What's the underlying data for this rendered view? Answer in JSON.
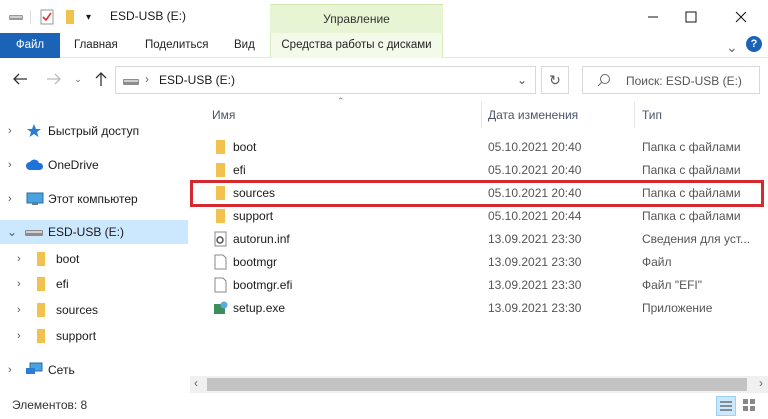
{
  "window": {
    "title": "ESD-USB (E:)",
    "manage_tab": "Управление"
  },
  "ribbon": {
    "tabs": [
      "Файл",
      "Главная",
      "Поделиться",
      "Вид",
      "Средства работы с дисками"
    ]
  },
  "address": {
    "path": "ESD-USB (E:)",
    "search_placeholder": "Поиск: ESD-USB (E:)"
  },
  "nav": {
    "items": [
      {
        "label": "Быстрый доступ",
        "icon": "star-icon"
      },
      {
        "label": "OneDrive",
        "icon": "cloud-icon"
      },
      {
        "label": "Этот компьютер",
        "icon": "computer-icon"
      },
      {
        "label": "ESD-USB (E:)",
        "icon": "drive-icon",
        "selected": true
      },
      {
        "label": "boot",
        "icon": "folder-icon"
      },
      {
        "label": "efi",
        "icon": "folder-icon"
      },
      {
        "label": "sources",
        "icon": "folder-icon"
      },
      {
        "label": "support",
        "icon": "folder-icon"
      },
      {
        "label": "Сеть",
        "icon": "network-icon"
      }
    ]
  },
  "columns": {
    "name": "Имя",
    "date": "Дата изменения",
    "type": "Тип"
  },
  "files": [
    {
      "name": "boot",
      "date": "05.10.2021 20:40",
      "type": "Папка с файлами",
      "icon": "folder-icon"
    },
    {
      "name": "efi",
      "date": "05.10.2021 20:40",
      "type": "Папка с файлами",
      "icon": "folder-icon"
    },
    {
      "name": "sources",
      "date": "05.10.2021 20:40",
      "type": "Папка с файлами",
      "icon": "folder-icon",
      "highlighted": true
    },
    {
      "name": "support",
      "date": "05.10.2021 20:44",
      "type": "Папка с файлами",
      "icon": "folder-icon"
    },
    {
      "name": "autorun.inf",
      "date": "13.09.2021 23:30",
      "type": "Сведения для уст...",
      "icon": "settings-file-icon"
    },
    {
      "name": "bootmgr",
      "date": "13.09.2021 23:30",
      "type": "Файл",
      "icon": "file-icon"
    },
    {
      "name": "bootmgr.efi",
      "date": "13.09.2021 23:30",
      "type": "Файл \"EFI\"",
      "icon": "file-icon"
    },
    {
      "name": "setup.exe",
      "date": "13.09.2021 23:30",
      "type": "Приложение",
      "icon": "app-icon"
    }
  ],
  "status": {
    "count_text": "Элементов: 8"
  },
  "colors": {
    "accent": "#1a63b6",
    "manage": "#e8f5d4",
    "selection": "#cce8ff",
    "highlight": "#d42a2f",
    "folder": "#f2c14e"
  }
}
